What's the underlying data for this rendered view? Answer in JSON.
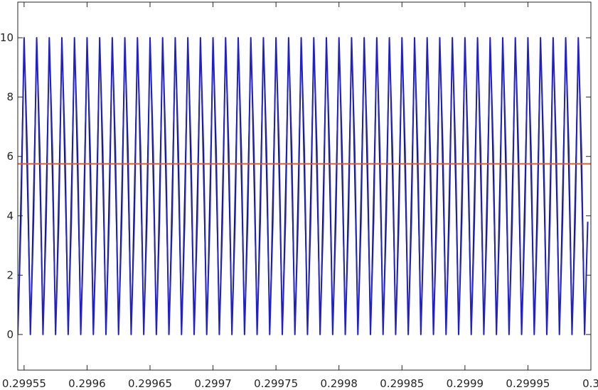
{
  "chart_data": {
    "type": "line",
    "title": "",
    "xlabel": "",
    "ylabel": "",
    "xlim": [
      0.299545,
      0.3
    ],
    "ylim": [
      -1.2,
      11.2
    ],
    "grid": false,
    "x_ticks": [
      0.29955,
      0.2996,
      0.29965,
      0.2997,
      0.29975,
      0.2998,
      0.29985,
      0.2999,
      0.29995,
      0.3
    ],
    "x_tick_labels": [
      "0.29955",
      "0.2996",
      "0.29965",
      "0.2997",
      "0.29975",
      "0.2998",
      "0.29985",
      "0.2999",
      "0.29995",
      "0.3"
    ],
    "y_ticks": [
      0,
      2,
      4,
      6,
      8,
      10
    ],
    "y_tick_labels": [
      "0",
      "2",
      "4",
      "6",
      "8",
      "10"
    ],
    "series": [
      {
        "color": "#1f1fcc",
        "style": "triangle-wave",
        "min": 0,
        "max": 10,
        "period": 1e-05,
        "first_peak_x": 0.29954,
        "num_peaks": 46
      },
      {
        "color": "#e05a2b",
        "style": "constant",
        "value": 5.75
      }
    ],
    "reference_line_color": "#000000"
  }
}
